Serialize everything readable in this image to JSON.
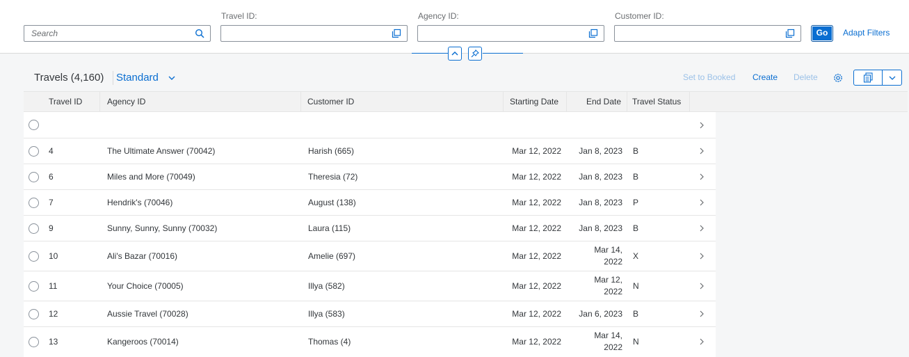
{
  "filterbar": {
    "search_placeholder": "Search",
    "travel_id_label": "Travel ID:",
    "agency_id_label": "Agency ID:",
    "customer_id_label": "Customer ID:",
    "go_label": "Go",
    "adapt_filters_label": "Adapt Filters"
  },
  "table_toolbar": {
    "title": "Travels (4,160)",
    "variant": "Standard",
    "set_to_booked": "Set to Booked",
    "create": "Create",
    "delete": "Delete"
  },
  "columns": [
    "Travel ID",
    "Agency ID",
    "Customer ID",
    "Starting Date",
    "End Date",
    "Travel Status"
  ],
  "rows": [
    {
      "travel_id": "",
      "agency": "",
      "customer": "",
      "start": "",
      "end_1": "",
      "end_2": "",
      "status": ""
    },
    {
      "travel_id": "4",
      "agency": "The Ultimate Answer (70042)",
      "customer": "Harish (665)",
      "start": "Mar 12, 2022",
      "end_1": "Jan 8, 2023",
      "end_2": "",
      "status": "B"
    },
    {
      "travel_id": "6",
      "agency": "Miles and More (70049)",
      "customer": "Theresia (72)",
      "start": "Mar 12, 2022",
      "end_1": "Jan 8, 2023",
      "end_2": "",
      "status": "B"
    },
    {
      "travel_id": "7",
      "agency": "Hendrik's (70046)",
      "customer": "August (138)",
      "start": "Mar 12, 2022",
      "end_1": "Jan 8, 2023",
      "end_2": "",
      "status": "P"
    },
    {
      "travel_id": "9",
      "agency": "Sunny, Sunny, Sunny (70032)",
      "customer": "Laura (115)",
      "start": "Mar 12, 2022",
      "end_1": "Jan 8, 2023",
      "end_2": "",
      "status": "B"
    },
    {
      "travel_id": "10",
      "agency": "Ali's Bazar (70016)",
      "customer": "Amelie (697)",
      "start": "Mar 12, 2022",
      "end_1": "Mar 14,",
      "end_2": "2022",
      "status": "X"
    },
    {
      "travel_id": "11",
      "agency": "Your Choice (70005)",
      "customer": "Illya (582)",
      "start": "Mar 12, 2022",
      "end_1": "Mar 12,",
      "end_2": "2022",
      "status": "N"
    },
    {
      "travel_id": "12",
      "agency": "Aussie Travel (70028)",
      "customer": "Illya (583)",
      "start": "Mar 12, 2022",
      "end_1": "Jan 6, 2023",
      "end_2": "",
      "status": "B"
    },
    {
      "travel_id": "13",
      "agency": "Kangeroos (70014)",
      "customer": "Thomas (4)",
      "start": "Mar 12, 2022",
      "end_1": "Mar 14,",
      "end_2": "2022",
      "status": "N"
    }
  ],
  "icons": {
    "search": "search-icon",
    "value_help": "value-help-icon",
    "collapse": "chevron-up-icon",
    "pin": "pin-icon",
    "variant_chevron": "chevron-down-icon",
    "settings": "gear-icon",
    "export": "export-icon",
    "row_nav": "chevron-right-icon"
  },
  "colors": {
    "accent": "#0a6ed1",
    "disabled_link": "#9bc1e8",
    "text": "#32363a",
    "background": "#f5f6f7"
  }
}
